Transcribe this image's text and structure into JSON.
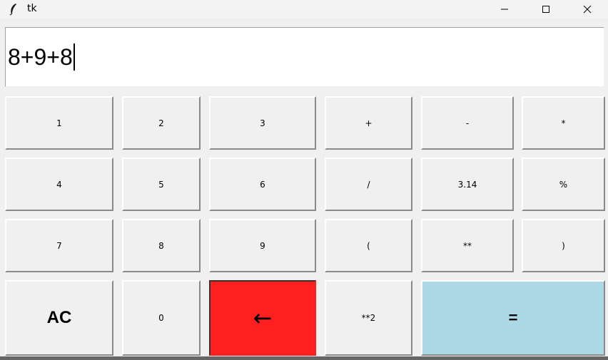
{
  "window": {
    "title": "tk",
    "icon": "feather-icon",
    "controls": [
      "minimize-icon",
      "maximize-icon",
      "close-icon"
    ]
  },
  "display": {
    "expression": "8+9+8"
  },
  "keys": {
    "k1": "1",
    "k2": "2",
    "k3": "3",
    "plus": "+",
    "minus": "-",
    "times": "*",
    "k4": "4",
    "k5": "5",
    "k6": "6",
    "divide": "/",
    "pi": "3.14",
    "mod": "%",
    "k7": "7",
    "k8": "8",
    "k9": "9",
    "lparen": "(",
    "power": "**",
    "rparen": ")",
    "ac": "AC",
    "k0": "0",
    "backspace": "←",
    "square": "**2",
    "equals": "="
  },
  "colors": {
    "backspace_bg": "#ff1f1f",
    "equals_bg": "#add8e6",
    "window_bg": "#f0f0f0"
  }
}
